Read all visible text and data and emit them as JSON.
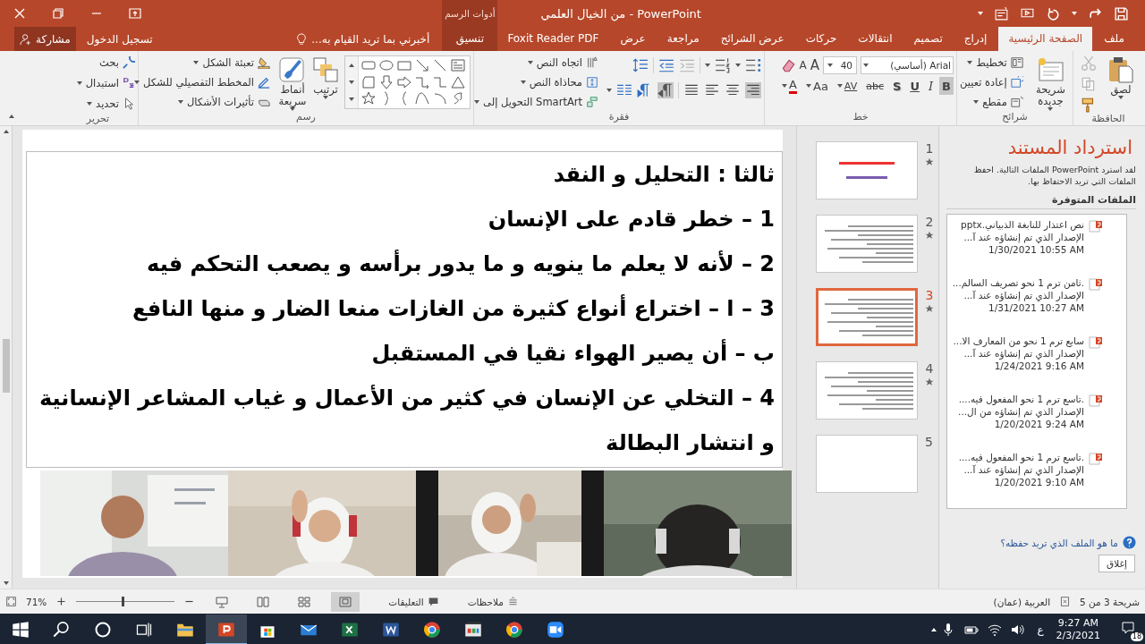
{
  "title_bar": {
    "title": "من الخيال العلمي - PowerPoint"
  },
  "account": {
    "share": "مشاركة",
    "sign_in": "تسجيل الدخول",
    "tell_me": "أخبرني بما تريد القيام به..."
  },
  "context_tab": {
    "group": "أدوات الرسم",
    "label": "تنسيق",
    "selected": false
  },
  "tabs": [
    {
      "label": "ملف",
      "selected": false
    },
    {
      "label": "الصفحة الرئيسية",
      "selected": true
    },
    {
      "label": "إدراج",
      "selected": false
    },
    {
      "label": "تصميم",
      "selected": false
    },
    {
      "label": "انتقالات",
      "selected": false
    },
    {
      "label": "حركات",
      "selected": false
    },
    {
      "label": "عرض الشرائح",
      "selected": false
    },
    {
      "label": "مراجعة",
      "selected": false
    },
    {
      "label": "عرض",
      "selected": false
    },
    {
      "label": "Foxit Reader PDF",
      "selected": false
    }
  ],
  "ribbon": {
    "clipboard": {
      "label": "الحافظة",
      "paste": "لصق"
    },
    "slides": {
      "label": "شرائح",
      "new_slide": "شريحة جديدة",
      "commands": [
        "تخطيط",
        "إعادة تعيين",
        "مقطع"
      ]
    },
    "font": {
      "label": "خط",
      "name": "Arial (أساسي)",
      "size": "40",
      "sizers": [
        "A",
        "A"
      ],
      "styles": [
        {
          "text": "B",
          "kind": "bold",
          "selected": true
        },
        {
          "text": "I",
          "kind": "italic",
          "selected": false
        },
        {
          "text": "U",
          "kind": "underline",
          "selected": false
        },
        {
          "text": "S",
          "kind": "shadow",
          "selected": false
        },
        {
          "text": "abc",
          "kind": "strike",
          "selected": false
        },
        {
          "text": "AV",
          "kind": "spacing",
          "selected": false
        },
        {
          "text": "Aa",
          "kind": "case",
          "selected": false
        },
        {
          "text": "A",
          "kind": "color",
          "selected": false
        }
      ]
    },
    "paragraph": {
      "label": "فقرة",
      "commands": [
        "اتجاه النص",
        "محاذاة النص",
        "التحويل إلى SmartArt"
      ],
      "alignment": [
        {
          "kind": "right",
          "selected": true
        },
        {
          "kind": "center",
          "selected": false
        },
        {
          "kind": "left",
          "selected": false
        },
        {
          "kind": "justify",
          "selected": false
        }
      ],
      "direction": [
        {
          "kind": "rtl",
          "selected": true
        },
        {
          "kind": "ltr",
          "selected": false
        }
      ]
    },
    "drawing": {
      "label": "رسم",
      "arrange": "ترتيب",
      "quick_styles": "أنماط سريعة",
      "commands": [
        "تعبئة الشكل",
        "المخطط التفصيلي للشكل",
        "تأثيرات الأشكال"
      ]
    },
    "editing": {
      "label": "تحرير",
      "commands": [
        "بحث",
        "استبدال",
        "تحديد"
      ]
    }
  },
  "slide": {
    "lines": [
      "ثالثا : التحليل و النقد",
      "1 – خطر قادم على الإنسان",
      "2 – لأنه لا يعلم ما ينويه و ما يدور برأسه و يصعب التحكم فيه",
      "3 – ا – اختراع أنواع كثيرة من الغازات منعا الضار و منها النافع",
      "ب – أن يصير الهواء نقيا في المستقبل",
      "4 – التخلي عن الإنسان في كثير من الأعمال و غياب المشاعر الإنسانية",
      "و انتشار البطالة"
    ]
  },
  "thumbnails": [
    {
      "number": "1",
      "kind": "title",
      "starred": true,
      "selected": false
    },
    {
      "number": "2",
      "kind": "text",
      "starred": true,
      "selected": false
    },
    {
      "number": "3",
      "kind": "text",
      "starred": true,
      "selected": true
    },
    {
      "number": "4",
      "kind": "text",
      "starred": true,
      "selected": false
    },
    {
      "number": "5",
      "kind": "blank",
      "starred": false,
      "selected": false
    }
  ],
  "recovery": {
    "title": "استرداد المستند",
    "description": "لقد استرد PowerPoint الملفات التالية. احفظ الملفات التي تريد الاحتفاظ بها.",
    "list_header": "الملفات المتوفرة",
    "files": [
      {
        "name": "نص اعتذار  للنابغة الذبياني.pptx",
        "info": "الإصدار الذي تم إنشاؤه عند آ...",
        "date": "1/30/2021 10:55 AM"
      },
      {
        "name": ".ثامن ترم 1 نحو تصريف السالم...",
        "info": "الإصدار الذي تم إنشاؤه عند آ...",
        "date": "1/31/2021 10:27 AM"
      },
      {
        "name": "سابع ترم 1 نحو من المعارف الا...",
        "info": "الإصدار الذي تم إنشاؤه عند آ...",
        "date": "1/24/2021 9:16 AM"
      },
      {
        "name": ".تاسع ترم 1 نحو المفعول فيه....",
        "info": "الإصدار الذي تم إنشاؤه من ال...",
        "date": "1/20/2021 9:24 AM"
      },
      {
        "name": ".تاسع ترم 1 نحو المفعول فيه....",
        "info": "الإصدار الذي تم إنشاؤه عند آ...",
        "date": "1/20/2021 9:10 AM"
      }
    ],
    "help_link": "ما هو الملف الذي تريد حفظه؟",
    "close": "إغلاق"
  },
  "status_bar": {
    "slide_count": "شريحة 3 من 5",
    "language": "العربية (عمان)",
    "notes": "ملاحظات",
    "comments": "التعليقات",
    "zoom": "71%",
    "zoom_slider": {
      "level": 0.47
    },
    "views": [
      {
        "kind": "normal",
        "selected": true
      },
      {
        "kind": "sorter",
        "selected": false
      },
      {
        "kind": "reading",
        "selected": false
      },
      {
        "kind": "slideshow",
        "selected": false
      }
    ]
  },
  "taskbar": {
    "input_language": "ع",
    "time": "9:27 AM",
    "date": "2/3/2021",
    "notifications": "18"
  }
}
